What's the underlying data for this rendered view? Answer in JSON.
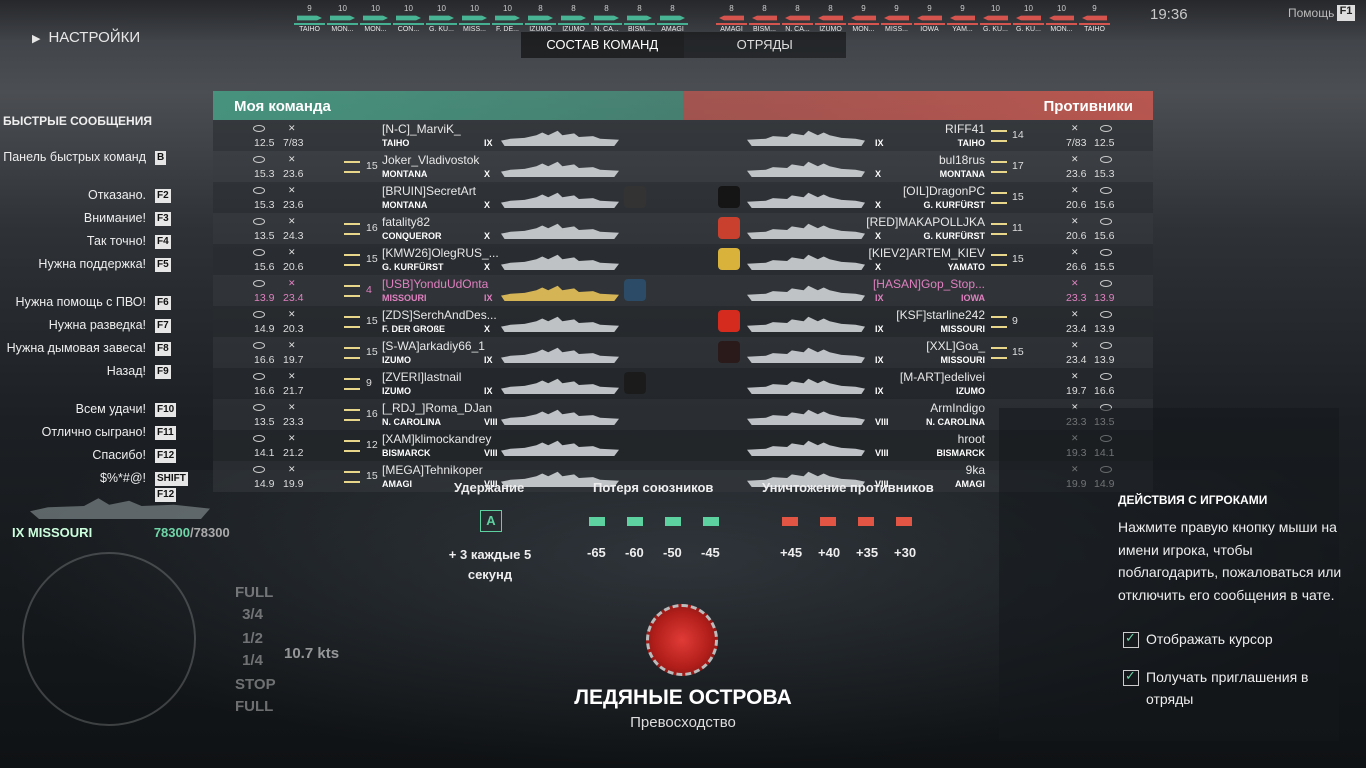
{
  "hud": {
    "clock": "19:36",
    "help": "Помощь",
    "help_key": "F1",
    "ally_ships": [
      {
        "tier": "9",
        "name": "TAIHO"
      },
      {
        "tier": "10",
        "name": "MON..."
      },
      {
        "tier": "10",
        "name": "MON..."
      },
      {
        "tier": "10",
        "name": "CON..."
      },
      {
        "tier": "10",
        "name": "G. KU..."
      },
      {
        "tier": "10",
        "name": "MISS..."
      },
      {
        "tier": "10",
        "name": "F. DE..."
      },
      {
        "tier": "8",
        "name": "IZUMO"
      },
      {
        "tier": "8",
        "name": "IZUMO"
      },
      {
        "tier": "8",
        "name": "N. CA..."
      },
      {
        "tier": "8",
        "name": "BISM..."
      },
      {
        "tier": "8",
        "name": "AMAGI"
      }
    ],
    "enemy_ships": [
      {
        "tier": "8",
        "name": "AMAGI"
      },
      {
        "tier": "8",
        "name": "BISM..."
      },
      {
        "tier": "8",
        "name": "N. CA..."
      },
      {
        "tier": "8",
        "name": "IZUMO"
      },
      {
        "tier": "9",
        "name": "MON..."
      },
      {
        "tier": "9",
        "name": "MISS..."
      },
      {
        "tier": "9",
        "name": "IOWA"
      },
      {
        "tier": "9",
        "name": "YAM..."
      },
      {
        "tier": "10",
        "name": "G. KU..."
      },
      {
        "tier": "10",
        "name": "G. KU..."
      },
      {
        "tier": "10",
        "name": "MON..."
      },
      {
        "tier": "9",
        "name": "TAIHO"
      }
    ]
  },
  "settings_label": "НАСТРОЙКИ",
  "tabs": [
    "СОСТАВ КОМАНД",
    "ОТРЯДЫ"
  ],
  "quick": {
    "title": "БЫСТРЫЕ СООБЩЕНИЯ",
    "items": [
      {
        "label": "Панель быстрых команд",
        "key": "B"
      },
      {
        "label": "Отказано.",
        "key": "F2"
      },
      {
        "label": "Внимание!",
        "key": "F3"
      },
      {
        "label": "Так точно!",
        "key": "F4"
      },
      {
        "label": "Нужна поддержка!",
        "key": "F5"
      },
      {
        "label": "Нужна помощь с ПВО!",
        "key": "F6"
      },
      {
        "label": "Нужна разведка!",
        "key": "F7"
      },
      {
        "label": "Нужна дымовая завеса!",
        "key": "F8"
      },
      {
        "label": "Назад!",
        "key": "F9"
      },
      {
        "label": "Всем удачи!",
        "key": "F10"
      },
      {
        "label": "Отлично сыграно!",
        "key": "F11"
      },
      {
        "label": "Спасибо!",
        "key": "F12"
      },
      {
        "label": "$%*#@!",
        "key": "SHIFT"
      },
      {
        "label": "",
        "key": "F12"
      }
    ]
  },
  "roster": {
    "my_title": "Моя команда",
    "enemy_title": "Противники",
    "my": [
      {
        "a": "12.5",
        "b": "7/83",
        "rank": "",
        "name": "[N-C]_MarviK_",
        "ship": "TAIHO",
        "tier": "IX"
      },
      {
        "a": "15.3",
        "b": "23.6",
        "rank": "15",
        "name": "Joker_Vladivostok",
        "ship": "MONTANA",
        "tier": "X"
      },
      {
        "a": "15.3",
        "b": "23.6",
        "rank": "",
        "name": "[BRUIN]SecretArt",
        "ship": "MONTANA",
        "tier": "X"
      },
      {
        "a": "13.5",
        "b": "24.3",
        "rank": "16",
        "name": "fatality82",
        "ship": "CONQUEROR",
        "tier": "X"
      },
      {
        "a": "15.6",
        "b": "20.6",
        "rank": "15",
        "name": "[KMW26]OlegRUS_...",
        "ship": "G. KURFÜRST",
        "tier": "X"
      },
      {
        "a": "13.9",
        "b": "23.4",
        "rank": "4",
        "name": "[USB]YonduUdOnta",
        "ship": "MISSOURI",
        "tier": "IX",
        "me": true
      },
      {
        "a": "14.9",
        "b": "20.3",
        "rank": "15",
        "name": "[ZDS]SerchAndDes...",
        "ship": "F. DER GROßE",
        "tier": "X"
      },
      {
        "a": "16.6",
        "b": "19.7",
        "rank": "15",
        "name": "[S-WA]arkadiy66_1",
        "ship": "IZUMO",
        "tier": "IX"
      },
      {
        "a": "16.6",
        "b": "21.7",
        "rank": "9",
        "name": "[ZVERI]lastnail",
        "ship": "IZUMO",
        "tier": "IX"
      },
      {
        "a": "13.5",
        "b": "23.3",
        "rank": "16",
        "name": "[_RDJ_]Roma_DJan",
        "ship": "N. CAROLINA",
        "tier": "VIII"
      },
      {
        "a": "14.1",
        "b": "21.2",
        "rank": "12",
        "name": "[XAM]klimockandrey",
        "ship": "BISMARCK",
        "tier": "VIII"
      },
      {
        "a": "14.9",
        "b": "19.9",
        "rank": "15",
        "name": "[MEGA]Tehnikoper",
        "ship": "AMAGI",
        "tier": "VIII"
      }
    ],
    "enemy": [
      {
        "a": "12.5",
        "b": "7/83",
        "rank": "14",
        "name": "RIFF41",
        "ship": "TAIHO",
        "tier": "IX"
      },
      {
        "a": "15.3",
        "b": "23.6",
        "rank": "17",
        "name": "bul18rus",
        "ship": "MONTANA",
        "tier": "X"
      },
      {
        "a": "15.6",
        "b": "20.6",
        "rank": "15",
        "name": "[OIL]DragonPC",
        "ship": "G. KURFÜRST",
        "tier": "X"
      },
      {
        "a": "15.6",
        "b": "20.6",
        "rank": "11",
        "name": "[RED]MAKAPOLLJKA",
        "ship": "G. KURFÜRST",
        "tier": "X"
      },
      {
        "a": "15.5",
        "b": "26.6",
        "rank": "15",
        "name": "[KIEV2]ARTEM_KIEV",
        "ship": "YAMATO",
        "tier": "X"
      },
      {
        "a": "13.9",
        "b": "23.3",
        "rank": "",
        "name": "[HASAN]Gop_Stop...",
        "ship": "IOWA",
        "tier": "IX"
      },
      {
        "a": "13.9",
        "b": "23.4",
        "rank": "9",
        "name": "[KSF]starline242",
        "ship": "MISSOURI",
        "tier": "IX"
      },
      {
        "a": "13.9",
        "b": "23.4",
        "rank": "15",
        "name": "[XXL]Goa_",
        "ship": "MISSOURI",
        "tier": "IX"
      },
      {
        "a": "16.6",
        "b": "19.7",
        "rank": "",
        "name": "[M-ART]edelivei",
        "ship": "IZUMO",
        "tier": "IX"
      },
      {
        "a": "13.5",
        "b": "23.3",
        "rank": "",
        "name": "ArmIndigo",
        "ship": "N. CAROLINA",
        "tier": "VIII"
      },
      {
        "a": "14.1",
        "b": "19.3",
        "rank": "",
        "name": "hroot",
        "ship": "BISMARCK",
        "tier": "VIII"
      },
      {
        "a": "14.9",
        "b": "19.9",
        "rank": "",
        "name": "9ka",
        "ship": "AMAGI",
        "tier": "VIII"
      }
    ]
  },
  "objectives": {
    "hold_title": "Удержание",
    "hold_badge": "A",
    "hold_text": "+ 3 каждые 5 секунд",
    "loss_title": "Потеря союзников",
    "loss_values": [
      "-65",
      "-60",
      "-50",
      "-45"
    ],
    "kill_title": "Уничтожение противников",
    "kill_values": [
      "+45",
      "+40",
      "+35",
      "+30"
    ]
  },
  "map": {
    "name": "ЛЕДЯНЫЕ ОСТРОВА",
    "mode": "Превосходство"
  },
  "actions": {
    "title": "ДЕЙСТВИЯ С ИГРОКАМИ",
    "text": "Нажмите правую кнопку мыши на имени игрока, чтобы поблагодарить, пожаловаться или отключить его сообщения в чате.",
    "opt1": "Отображать курсор",
    "opt2": "Получать приглашения в отряды"
  },
  "ship_panel": {
    "name": "IX MISSOURI",
    "hp": "78300",
    "hp_max": "/78300",
    "speed": "10.7 kts"
  },
  "throttle": [
    "FULL",
    "3/4",
    "1/2",
    "1/4",
    "STOP",
    "FULL"
  ],
  "colors": {
    "ally": "#46b093",
    "enemy": "#d6544e",
    "me": "#e080c0"
  }
}
